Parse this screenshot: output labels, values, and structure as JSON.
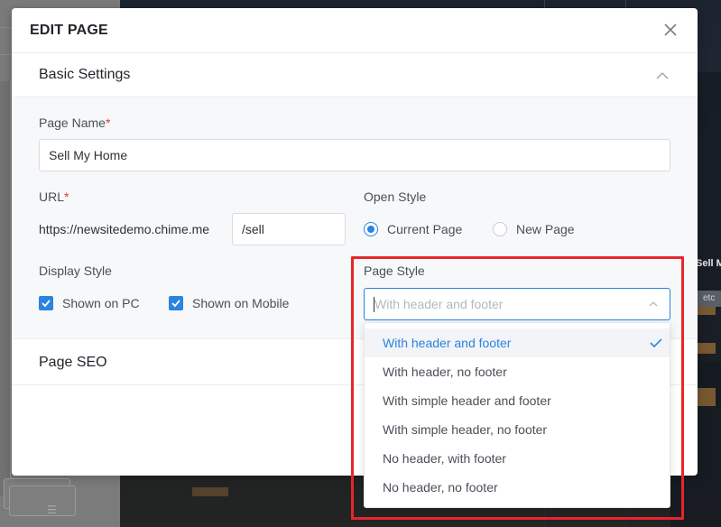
{
  "modal": {
    "title": "EDIT PAGE"
  },
  "basic_settings": {
    "heading": "Basic Settings",
    "page_name": {
      "label": "Page Name",
      "required_mark": "*",
      "value": "Sell My Home"
    },
    "url": {
      "label": "URL",
      "required_mark": "*",
      "prefix": "https://newsitedemo.chime.me",
      "value": "/sell"
    },
    "open_style": {
      "label": "Open Style",
      "options": [
        {
          "label": "Current Page",
          "selected": true
        },
        {
          "label": "New Page",
          "selected": false
        }
      ]
    },
    "display_style": {
      "label": "Display Style",
      "options": [
        {
          "label": "Shown on PC",
          "checked": true
        },
        {
          "label": "Shown on Mobile",
          "checked": true
        }
      ]
    },
    "page_style": {
      "label": "Page Style",
      "placeholder": "With header and footer",
      "options": [
        {
          "label": "With header and footer",
          "selected": true
        },
        {
          "label": "With header, no footer",
          "selected": false
        },
        {
          "label": "With simple header and footer",
          "selected": false
        },
        {
          "label": "With simple header, no footer",
          "selected": false
        },
        {
          "label": "No header, with footer",
          "selected": false
        },
        {
          "label": "No header, no footer",
          "selected": false
        }
      ]
    }
  },
  "page_seo": {
    "heading": "Page SEO"
  },
  "background": {
    "sell_text": "Sell M",
    "etc_text": "etc"
  },
  "colors": {
    "accent": "#2a84e0",
    "highlight": "#e5262a",
    "required": "#e0393e"
  }
}
